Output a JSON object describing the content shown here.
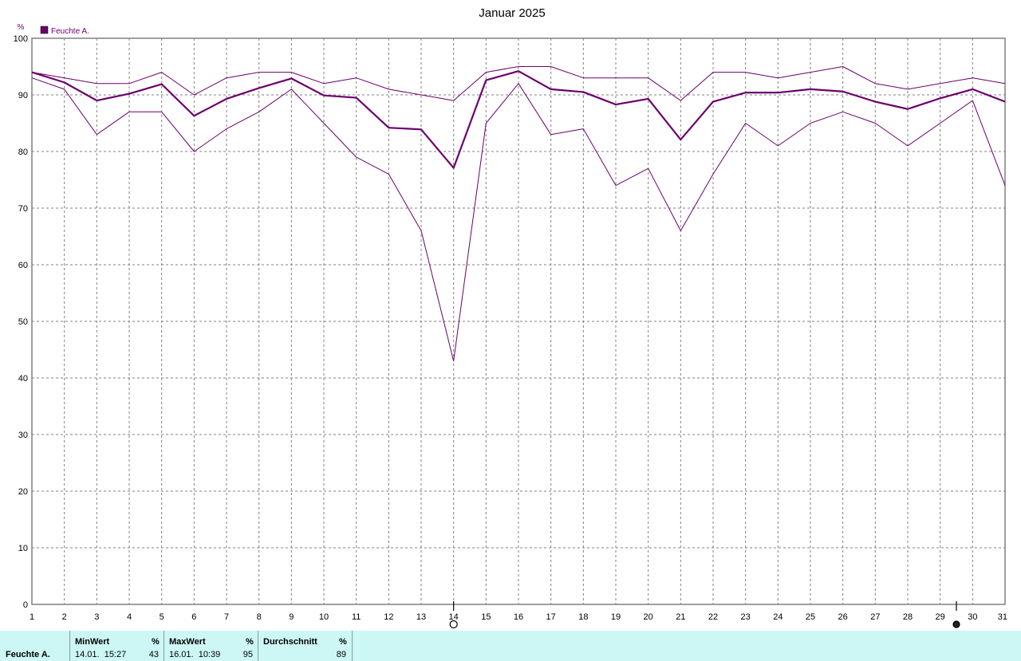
{
  "chart_data": {
    "type": "line",
    "title": "Januar 2025",
    "ylabel": "%",
    "xlabel": "",
    "ylim": [
      0,
      100
    ],
    "xlim": [
      1,
      31
    ],
    "yticks": [
      0,
      10,
      20,
      30,
      40,
      50,
      60,
      70,
      80,
      90,
      100
    ],
    "xticks": [
      1,
      2,
      3,
      4,
      5,
      6,
      7,
      8,
      9,
      10,
      11,
      12,
      13,
      14,
      15,
      16,
      17,
      18,
      19,
      20,
      21,
      22,
      23,
      24,
      25,
      26,
      27,
      28,
      29,
      30,
      31
    ],
    "grid": true,
    "legend": {
      "position": "top-left",
      "label": "Feuchte A.",
      "color": "#6b006b"
    },
    "color": "#6b006b",
    "x": [
      1,
      2,
      3,
      4,
      5,
      6,
      7,
      8,
      9,
      10,
      11,
      12,
      13,
      14,
      15,
      16,
      17,
      18,
      19,
      20,
      21,
      22,
      23,
      24,
      25,
      26,
      27,
      28,
      29,
      30,
      31
    ],
    "series": [
      {
        "role": "max",
        "values": [
          94,
          93,
          92,
          92,
          94,
          90,
          93,
          94,
          94,
          92,
          93,
          91,
          90,
          89,
          94,
          95,
          95,
          93,
          93,
          93,
          89,
          94,
          94,
          93,
          94,
          95,
          92,
          91,
          92,
          93,
          92
        ]
      },
      {
        "role": "avg",
        "values": [
          94,
          92.2,
          89,
          90.2,
          91.9,
          86.3,
          89.3,
          91.2,
          92.9,
          89.9,
          89.5,
          84.2,
          83.9,
          77.1,
          92.6,
          94.2,
          91,
          90.5,
          88.3,
          89.3,
          82.1,
          88.8,
          90.4,
          90.4,
          91,
          90.6,
          88.8,
          87.5,
          89.4,
          91,
          88.8
        ]
      },
      {
        "role": "min",
        "values": [
          93,
          91,
          83,
          87,
          87,
          80,
          84,
          87,
          91,
          85,
          79,
          76,
          66,
          43,
          85,
          92,
          83,
          84,
          74,
          77,
          66,
          76,
          85,
          81,
          85,
          87,
          85,
          81,
          85,
          89,
          74
        ]
      }
    ],
    "moon_phases": [
      {
        "day": 14,
        "phase": "full-moon"
      },
      {
        "day": 29.5,
        "phase": "new-moon"
      }
    ]
  },
  "summary": {
    "series_label": "Feuchte A.",
    "min": {
      "label": "MinWert",
      "unit": "%",
      "datetime": "14.01.  15:27",
      "value": "43"
    },
    "max": {
      "label": "MaxWert",
      "unit": "%",
      "datetime": "16.01.  10:39",
      "value": "95"
    },
    "avg": {
      "label": "Durchschnitt",
      "unit": "%",
      "value": "89"
    }
  }
}
